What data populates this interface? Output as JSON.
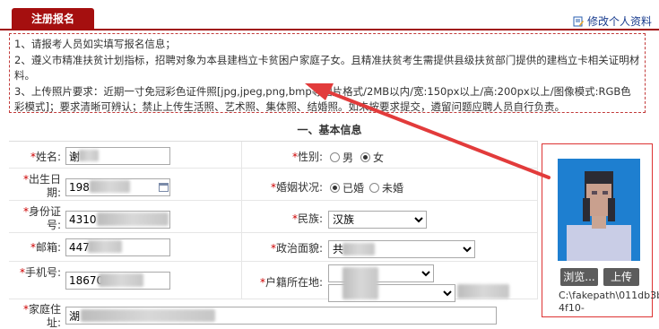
{
  "tab": {
    "label": "注册报名"
  },
  "edit_link": {
    "label": "修改个人资料"
  },
  "notice": {
    "line1": "1、请报考人员如实填写报名信息；",
    "line2": "2、遵义市精准扶贫计划指标，招聘对象为本县建档立卡贫困户家庭子女。且精准扶贫考生需提供县级扶贫部门提供的建档立卡相关证明材料。",
    "line3": "3、上传照片要求：近期一寸免冠彩色证件照[jpg,jpeg,png,bmp等图片格式/2MB以内/宽:150px以上/高:200px以上/图像模式:RGB色彩模式]；要求清晰可辨认；禁止上传生活照、艺术照、集体照、结婚照。如未按要求提交，遴留问题应聘人员自行负责。"
  },
  "section_title": "一、基本信息",
  "form": {
    "name": {
      "label": "姓名:",
      "value": "谢"
    },
    "birth": {
      "label": "出生日期:",
      "value": "198"
    },
    "id_no": {
      "label": "身份证号:",
      "value": "4310"
    },
    "postcode": {
      "label": "邮箱:",
      "value": "447"
    },
    "phone": {
      "label": "手机号:",
      "value": "18670"
    },
    "address": {
      "label": "家庭住址:",
      "value": "湖"
    },
    "gender": {
      "label": "性别:",
      "options": [
        "男",
        "女"
      ],
      "selected": "女"
    },
    "marital": {
      "label": "婚姻状况:",
      "options": [
        "已婚",
        "未婚"
      ],
      "selected": "已婚"
    },
    "ethnicity": {
      "label": "民族:",
      "value": "汉族"
    },
    "political": {
      "label": "政治面貌:",
      "value": "共"
    },
    "household": {
      "label": "户籍所在地:"
    }
  },
  "photo": {
    "browse_label": "浏览...",
    "upload_label": "上传",
    "path": "C:\\fakepath\\011db3b1-4f10-"
  },
  "colors": {
    "tab_bg": "#a50f0f",
    "notice_border": "#c23a3a",
    "arrow": "#e23b3b",
    "photo_bg": "#1e7fd0"
  }
}
